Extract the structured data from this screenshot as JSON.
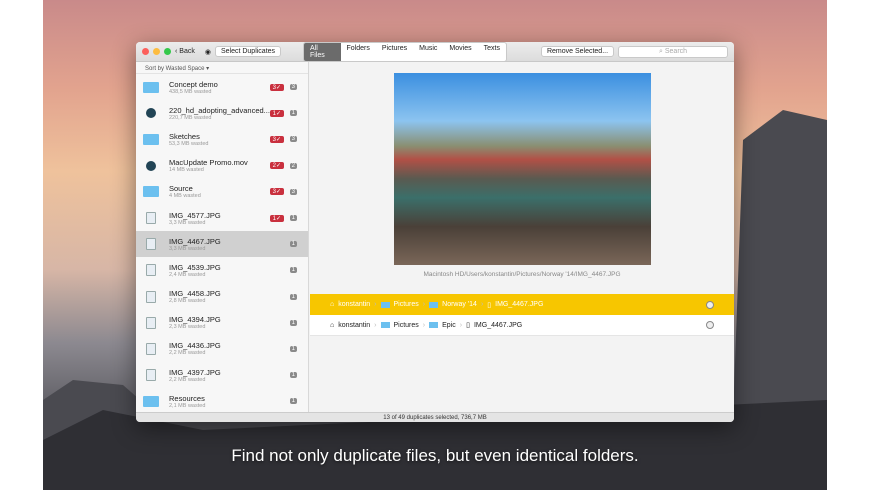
{
  "toolbar": {
    "back": "Back",
    "select_duplicates": "Select Duplicates",
    "tabs": [
      "All Files",
      "Folders",
      "Pictures",
      "Music",
      "Movies",
      "Texts"
    ],
    "remove": "Remove Selected...",
    "search_placeholder": "Search"
  },
  "sidebar": {
    "sort": "Sort by Wasted Space",
    "items": [
      {
        "name": "Concept demo",
        "size": "438,5 MB wasted",
        "type": "folder",
        "selected": "3",
        "count": "3"
      },
      {
        "name": "220_hd_adopting_advanced...",
        "size": "220,7 MB wasted",
        "type": "movie",
        "selected": "1",
        "count": "1"
      },
      {
        "name": "Sketches",
        "size": "53,3 MB wasted",
        "type": "folder",
        "selected": "3",
        "count": "3"
      },
      {
        "name": "MacUpdate Promo.mov",
        "size": "14 MB wasted",
        "type": "movie",
        "selected": "2",
        "count": "2"
      },
      {
        "name": "Source",
        "size": "4 MB wasted",
        "type": "folder",
        "selected": "3",
        "count": "3"
      },
      {
        "name": "IMG_4577.JPG",
        "size": "3,3 MB wasted",
        "type": "file",
        "selected": "1",
        "count": "1"
      },
      {
        "name": "IMG_4467.JPG",
        "size": "3,3 MB wasted",
        "type": "file",
        "selected": "",
        "count": "1"
      },
      {
        "name": "IMG_4539.JPG",
        "size": "2,4 MB wasted",
        "type": "file",
        "selected": "",
        "count": "1"
      },
      {
        "name": "IMG_4458.JPG",
        "size": "2,8 MB wasted",
        "type": "file",
        "selected": "",
        "count": "1"
      },
      {
        "name": "IMG_4394.JPG",
        "size": "2,3 MB wasted",
        "type": "file",
        "selected": "",
        "count": "1"
      },
      {
        "name": "IMG_4436.JPG",
        "size": "2,2 MB wasted",
        "type": "file",
        "selected": "",
        "count": "1"
      },
      {
        "name": "IMG_4397.JPG",
        "size": "2,2 MB wasted",
        "type": "file",
        "selected": "",
        "count": "1"
      },
      {
        "name": "Resources",
        "size": "2,1 MB wasted",
        "type": "folder",
        "selected": "",
        "count": "1"
      }
    ]
  },
  "preview": {
    "path": "Macintosh HD/Users/konstantin/Pictures/Norway '14/IMG_4467.JPG"
  },
  "locations": [
    [
      "konstantin",
      "Pictures",
      "Norway '14",
      "IMG_4467.JPG"
    ],
    [
      "konstantin",
      "Pictures",
      "Epic",
      "IMG_4467.JPG"
    ]
  ],
  "status": "13 of 49 duplicates selected, 736,7 MB",
  "caption": "Find not only duplicate files, but even identical folders."
}
